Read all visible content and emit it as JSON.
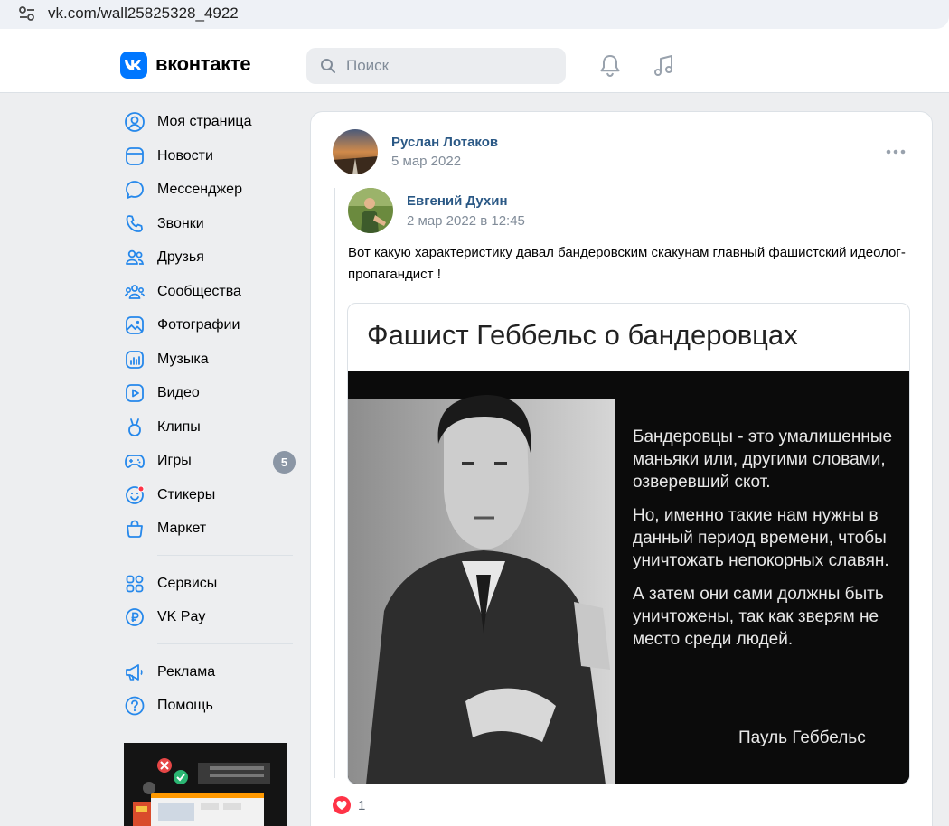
{
  "browser": {
    "url": "vk.com/wall25825328_4922"
  },
  "header": {
    "brand": "вконтакте",
    "search_placeholder": "Поиск"
  },
  "sidebar": {
    "items": [
      {
        "label": "Моя страница",
        "icon": "user-circle-icon"
      },
      {
        "label": "Новости",
        "icon": "newsfeed-icon"
      },
      {
        "label": "Мессенджер",
        "icon": "message-icon"
      },
      {
        "label": "Звонки",
        "icon": "phone-icon"
      },
      {
        "label": "Друзья",
        "icon": "friends-icon"
      },
      {
        "label": "Сообщества",
        "icon": "communities-icon"
      },
      {
        "label": "Фотографии",
        "icon": "photos-icon"
      },
      {
        "label": "Музыка",
        "icon": "music-icon"
      },
      {
        "label": "Видео",
        "icon": "video-icon"
      },
      {
        "label": "Клипы",
        "icon": "clips-icon"
      },
      {
        "label": "Игры",
        "icon": "games-icon",
        "badge": "5"
      },
      {
        "label": "Стикеры",
        "icon": "stickers-icon"
      },
      {
        "label": "Маркет",
        "icon": "market-icon"
      }
    ],
    "secondary": [
      {
        "label": "Сервисы",
        "icon": "services-icon"
      },
      {
        "label": "VK Pay",
        "icon": "vkpay-icon"
      }
    ],
    "tertiary": [
      {
        "label": "Реклама",
        "icon": "ads-icon"
      },
      {
        "label": "Помощь",
        "icon": "help-icon"
      }
    ]
  },
  "post": {
    "author": "Руслан Лотаков",
    "date": "5 мар 2022",
    "repost": {
      "author": "Евгений Духин",
      "date": "2 мар 2022 в 12:45",
      "text": "Вот какую характеристику давал бандеровским скакунам главный фашистский идеолог-пропагандист !",
      "attachment": {
        "title": "Фашист Геббельс о бандеровцах",
        "quote": [
          "Бандеровцы - это умалишенные маньяки или, другими словами, озверевший скот.",
          "Но, именно такие нам нужны в данный период времени, чтобы уничтожать непокорных славян.",
          "А затем они сами должны быть уничтожены, так как зверям не место среди людей."
        ],
        "signature": "Пауль Геббельс"
      }
    },
    "likes": "1"
  },
  "colors": {
    "accent": "#0077ff",
    "link": "#2a5885",
    "muted": "#818c99",
    "bg": "#edeef0",
    "like": "#ff3347"
  }
}
